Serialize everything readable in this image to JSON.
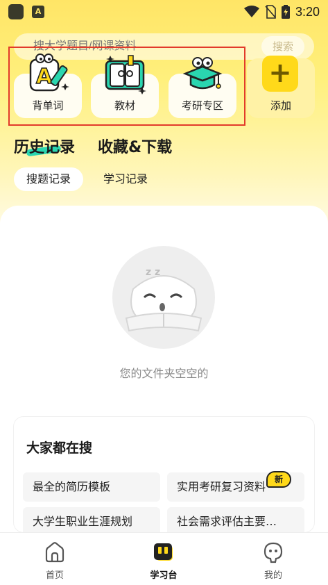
{
  "status_bar": {
    "time": "3:20",
    "app2_letter": "A"
  },
  "search": {
    "placeholder": "搜大学题目/网课资料",
    "button": "搜索"
  },
  "quick_tiles": [
    {
      "label": "背单词",
      "icon": "vocabulary-icon"
    },
    {
      "label": "教材",
      "icon": "textbook-icon"
    },
    {
      "label": "考研专区",
      "icon": "graduate-cap-icon"
    }
  ],
  "add_tile": {
    "label": "添加",
    "symbol": "+"
  },
  "main_tabs": [
    {
      "label": "历史记录",
      "active": true
    },
    {
      "label": "收藏&下载",
      "active": false
    }
  ],
  "sub_tabs": [
    {
      "label": "搜题记录",
      "active": true
    },
    {
      "label": "学习记录",
      "active": false
    }
  ],
  "empty_state": {
    "text": "您的文件夹空空的",
    "zz": "z z"
  },
  "hot_search": {
    "title": "大家都在搜",
    "items": [
      "最全的简历模板",
      "实用考研复习资料",
      "大学生职业生涯规划",
      "社会需求评估主要…"
    ],
    "new_badge": "新"
  },
  "bottom_nav": [
    {
      "label": "首页",
      "active": false
    },
    {
      "label": "学习台",
      "active": true
    },
    {
      "label": "我的",
      "active": false
    }
  ],
  "colors": {
    "accent": "#ffd91a",
    "highlight_box": "#e23a2a",
    "tab_underline": "#2ad6b0"
  }
}
